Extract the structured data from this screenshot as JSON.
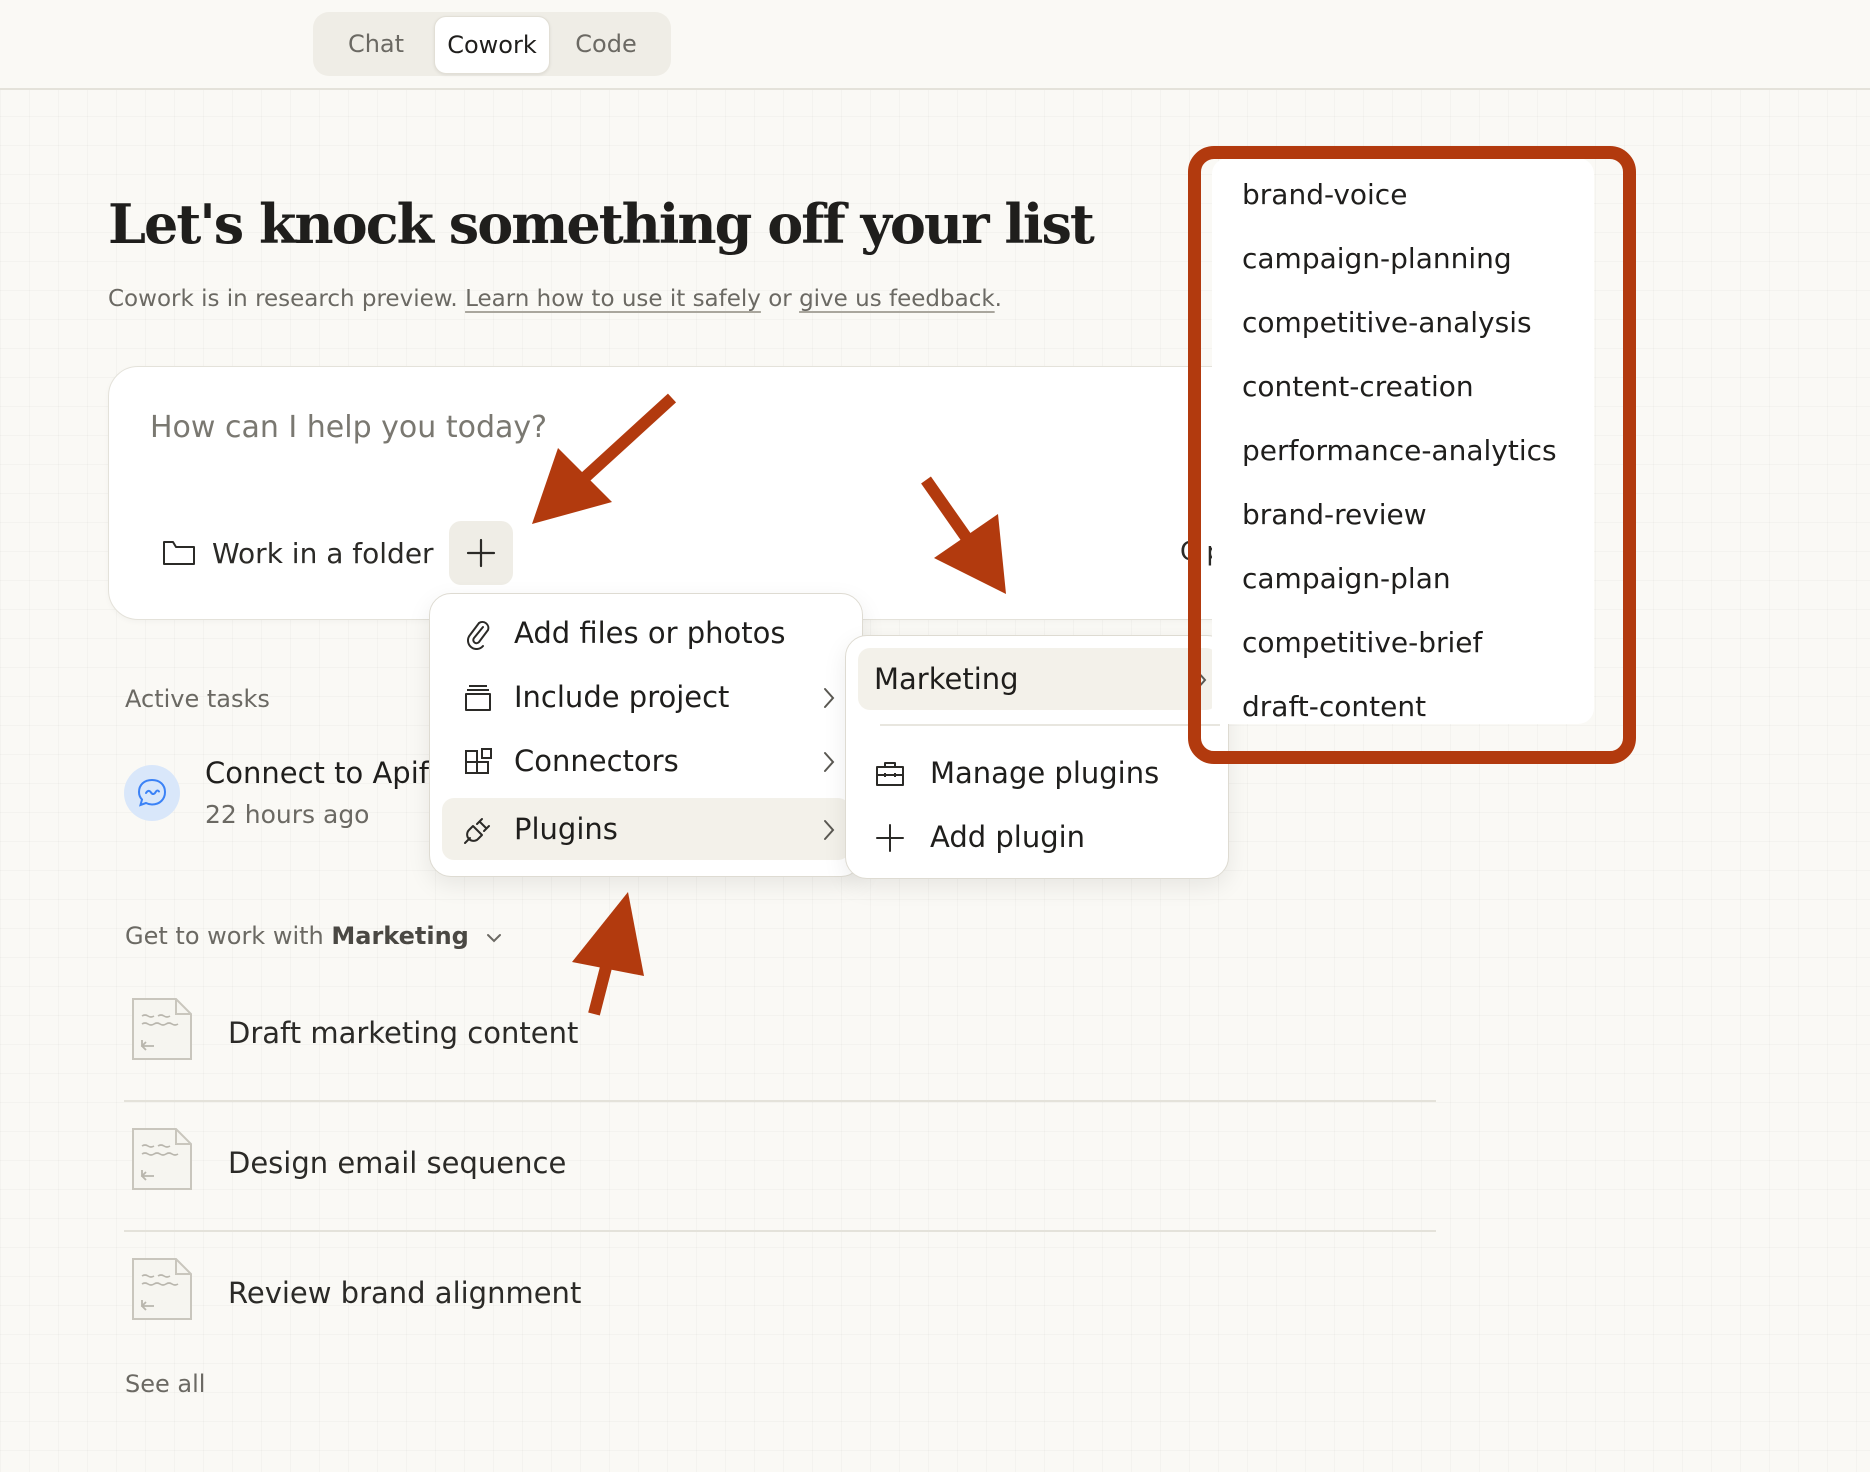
{
  "modes": [
    {
      "label": "Chat",
      "active": false
    },
    {
      "label": "Cowork",
      "active": true
    },
    {
      "label": "Code",
      "active": false
    }
  ],
  "page": {
    "title": "Let's knock something off your list",
    "subtitle_prefix": "Cowork is in research preview. ",
    "subtitle_link1": "Learn how to use it safely",
    "subtitle_mid": " or ",
    "subtitle_link2": "give us feedback",
    "subtitle_suffix": "."
  },
  "composer": {
    "placeholder": "How can I help you today?",
    "folder_label": "Work in a folder",
    "plus_icon": "plus-icon",
    "truncated_label": "C p"
  },
  "active_tasks": {
    "label": "Active tasks",
    "items": [
      {
        "title": "Connect to Apify",
        "time": "22 hours ago",
        "icon": "chat-bubble-icon"
      }
    ]
  },
  "suggestions": {
    "label_prefix": "Get to work with ",
    "plugin_name": "Marketing",
    "items": [
      {
        "label": "Draft marketing content"
      },
      {
        "label": "Design email sequence"
      },
      {
        "label": "Review brand alignment"
      }
    ],
    "see_all": "See all"
  },
  "add_menu": {
    "items": [
      {
        "label": "Add files or photos",
        "icon": "paperclip-icon",
        "has_submenu": false
      },
      {
        "label": "Include project",
        "icon": "project-box-icon",
        "has_submenu": true
      },
      {
        "label": "Connectors",
        "icon": "connectors-grid-icon",
        "has_submenu": true
      },
      {
        "label": "Plugins",
        "icon": "plug-icon",
        "has_submenu": true,
        "highlighted": true
      }
    ]
  },
  "plugins_menu": {
    "selected": "Marketing",
    "manage_label": "Manage plugins",
    "add_label": "Add plugin"
  },
  "plugin_skills": [
    "brand-voice",
    "campaign-planning",
    "competitive-analysis",
    "content-creation",
    "performance-analytics",
    "brand-review",
    "campaign-plan",
    "competitive-brief",
    "draft-content"
  ],
  "colors": {
    "annotation": "#b23a0e",
    "background": "#faf9f5",
    "avatar_bg": "#d9e7fa",
    "avatar_fg": "#3b82f6"
  }
}
